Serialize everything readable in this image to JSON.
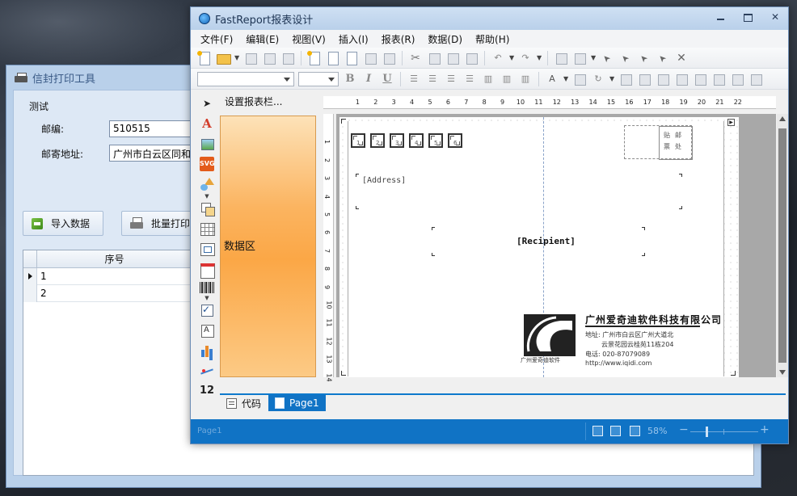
{
  "bg_window": {
    "title": "信封打印工具",
    "group_label": "测试",
    "postcode_label": "邮编:",
    "postcode_value": "510515",
    "address_label": "邮寄地址:",
    "address_value": "广州市白云区同和",
    "import_button": "导入数据",
    "batch_print_button": "批量打印",
    "grid": {
      "column_header": "序号",
      "rows": [
        "1",
        "2"
      ]
    }
  },
  "fr_window": {
    "title": "FastReport报表设计",
    "close_glyph": "✕",
    "menu": [
      "文件(F)",
      "编辑(E)",
      "视图(V)",
      "插入(I)",
      "报表(R)",
      "数据(D)",
      "帮助(H)"
    ],
    "band_header": "设置报表栏...",
    "band_data": "数据区",
    "ruler_top": [
      "1",
      "2",
      "3",
      "4",
      "5",
      "6",
      "7",
      "8",
      "9",
      "10",
      "11",
      "12",
      "13",
      "14",
      "15",
      "16",
      "17",
      "18",
      "19",
      "20",
      "21",
      "22"
    ],
    "ruler_left": [
      "1",
      "2",
      "3",
      "4",
      "5",
      "6",
      "7",
      "8",
      "9",
      "10",
      "11",
      "12",
      "13",
      "14"
    ],
    "nav_arrows": "◀▶",
    "page": {
      "zip_digits": [
        "1",
        "2",
        "3",
        "4",
        "5",
        "6"
      ],
      "stamp_text": "贴邮票处",
      "address_field": "[Address]",
      "recipient_field": "[Recipient]",
      "company_name": "广州爱奇迪软件科技有限公司",
      "logo_caption": "广州爱奇迪软件",
      "address_line1": "地址: 广州市白云区广州大道北",
      "address_line2": "云景花园云桂苑11栋204",
      "phone_line": "电话: 020-87079089",
      "web_line": "http://www.iqidi.com"
    },
    "tabs": {
      "code": "代码",
      "page1": "Page1"
    },
    "status": {
      "left_text": "Page1",
      "zoom": "58%",
      "zoom_minus": "−",
      "zoom_plus": "+"
    },
    "toolbar_glyphs": {
      "bold": "B",
      "italic": "I",
      "underline": "U",
      "text_object": "A",
      "svg": "SVG",
      "digits": "12"
    }
  },
  "colors": {
    "accent": "#1073c5",
    "band_orange": "#fba746",
    "window_blue": "#b9d0ea"
  }
}
